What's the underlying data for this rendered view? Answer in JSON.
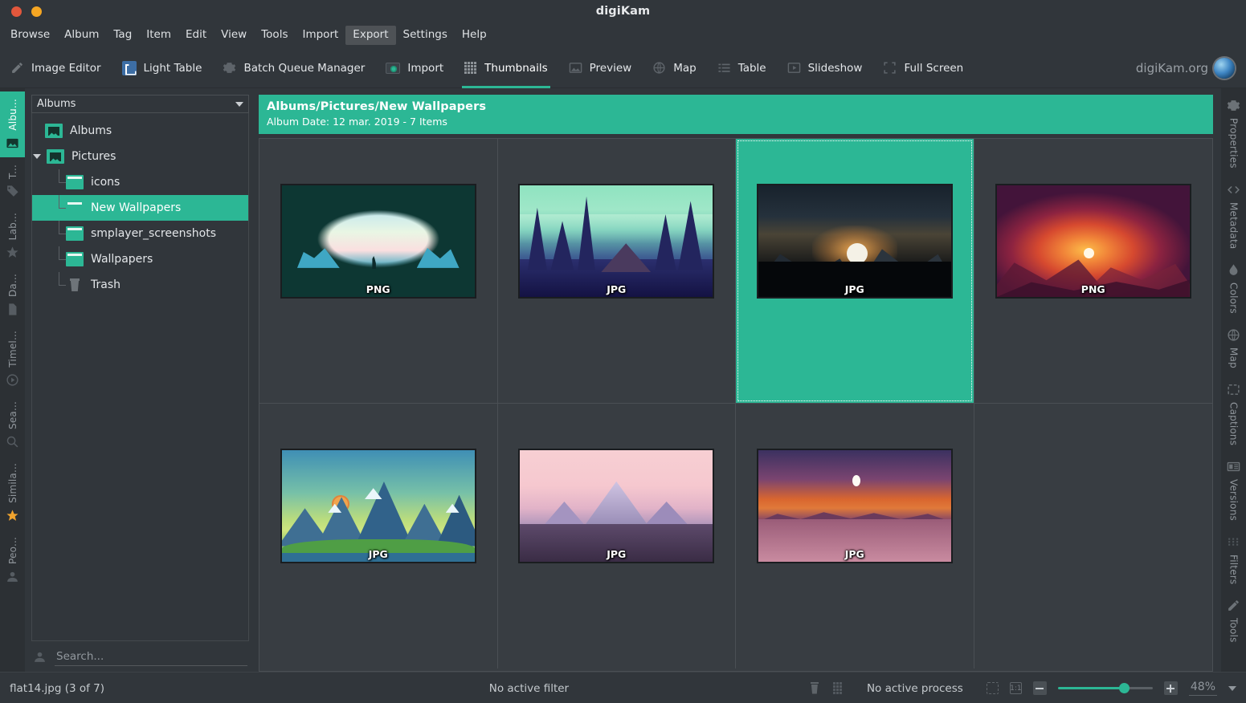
{
  "window": {
    "title": "digiKam",
    "controls": [
      {
        "name": "close",
        "color": "#e2573c"
      },
      {
        "name": "minimize",
        "color": "#f5a623"
      }
    ]
  },
  "menubar": {
    "items": [
      {
        "label": "Browse",
        "active": false
      },
      {
        "label": "Album",
        "active": false
      },
      {
        "label": "Tag",
        "active": false
      },
      {
        "label": "Item",
        "active": false
      },
      {
        "label": "Edit",
        "active": false
      },
      {
        "label": "View",
        "active": false
      },
      {
        "label": "Tools",
        "active": false
      },
      {
        "label": "Import",
        "active": false
      },
      {
        "label": "Export",
        "active": true
      },
      {
        "label": "Settings",
        "active": false
      },
      {
        "label": "Help",
        "active": false
      }
    ]
  },
  "toolbar": {
    "items": [
      {
        "label": "Image Editor",
        "icon": "pencil-icon",
        "selected": false
      },
      {
        "label": "Light Table",
        "icon": "light-table-icon",
        "selected": false
      },
      {
        "label": "Batch Queue Manager",
        "icon": "gear-icon",
        "selected": false
      },
      {
        "label": "Import",
        "icon": "import-icon",
        "selected": false
      },
      {
        "label": "Thumbnails",
        "icon": "grid-icon",
        "selected": true
      },
      {
        "label": "Preview",
        "icon": "picture-icon",
        "selected": false
      },
      {
        "label": "Map",
        "icon": "globe-icon",
        "selected": false
      },
      {
        "label": "Table",
        "icon": "list-icon",
        "selected": false
      },
      {
        "label": "Slideshow",
        "icon": "play-icon",
        "selected": false
      },
      {
        "label": "Full Screen",
        "icon": "fullscreen-icon",
        "selected": false
      }
    ],
    "brand": "digiKam.org",
    "accent": "#2cb795"
  },
  "left_strip": {
    "tabs": [
      {
        "label": "Albu...",
        "icon": "picture-icon",
        "active": true
      },
      {
        "label": "T...",
        "icon": "tag-icon",
        "active": false
      },
      {
        "label": "Lab...",
        "icon": "star-icon",
        "active": false
      },
      {
        "label": "Da...",
        "icon": "document-icon",
        "active": false
      },
      {
        "label": "Timel...",
        "icon": "clock-icon",
        "active": false
      },
      {
        "label": "Sea...",
        "icon": "search-icon",
        "active": false
      },
      {
        "label": "Simila...",
        "icon": "star-filled-icon",
        "active": false
      },
      {
        "label": "Peo...",
        "icon": "people-icon",
        "active": false
      }
    ]
  },
  "right_strip": {
    "tabs": [
      {
        "label": "Properties",
        "icon": "gear-icon"
      },
      {
        "label": "Metadata",
        "icon": "code-icon"
      },
      {
        "label": "Colors",
        "icon": "droplet-icon"
      },
      {
        "label": "Map",
        "icon": "globe-icon"
      },
      {
        "label": "Captions",
        "icon": "caption-icon"
      },
      {
        "label": "Versions",
        "icon": "versions-icon"
      },
      {
        "label": "Filters",
        "icon": "filters-icon"
      },
      {
        "label": "Tools",
        "icon": "pencil-icon"
      }
    ]
  },
  "sidebar": {
    "combo_label": "Albums",
    "tree": [
      {
        "label": "Albums",
        "depth": 0,
        "icon": "album-root-icon",
        "selected": false,
        "expander": false
      },
      {
        "label": "Pictures",
        "depth": 1,
        "icon": "album-image-icon",
        "selected": false,
        "expander": true
      },
      {
        "label": "icons",
        "depth": 2,
        "icon": "folder-icon",
        "selected": false,
        "expander": false
      },
      {
        "label": "New Wallpapers",
        "depth": 2,
        "icon": "folder-icon",
        "selected": true,
        "expander": false
      },
      {
        "label": "smplayer_screenshots",
        "depth": 2,
        "icon": "folder-icon",
        "selected": false,
        "expander": false
      },
      {
        "label": "Wallpapers",
        "depth": 2,
        "icon": "folder-icon",
        "selected": false,
        "expander": false
      },
      {
        "label": "Trash",
        "depth": 2,
        "icon": "trash-icon",
        "selected": false,
        "expander": false
      }
    ],
    "search_placeholder": "Search..."
  },
  "album_banner": {
    "path": "Albums/Pictures/New Wallpapers",
    "meta": "Album Date: 12 mar. 2019 - 7 Items",
    "bg": "#2cb795"
  },
  "thumbnails": {
    "items": [
      {
        "badge": "PNG",
        "art": "a-cave",
        "selected": false
      },
      {
        "badge": "JPG",
        "art": "a-forest",
        "selected": false
      },
      {
        "badge": "JPG",
        "art": "a-night",
        "selected": true
      },
      {
        "badge": "PNG",
        "art": "a-red",
        "selected": false
      },
      {
        "badge": "JPG",
        "art": "a-green",
        "selected": false
      },
      {
        "badge": "JPG",
        "art": "a-pink",
        "selected": false
      },
      {
        "badge": "JPG",
        "art": "a-lake",
        "selected": false
      },
      {
        "badge": "",
        "art": "",
        "selected": false
      }
    ]
  },
  "statusbar": {
    "filename": "flat14.jpg (3 of 7)",
    "filter": "No active filter",
    "process": "No active process",
    "zoom_level": "48%"
  }
}
